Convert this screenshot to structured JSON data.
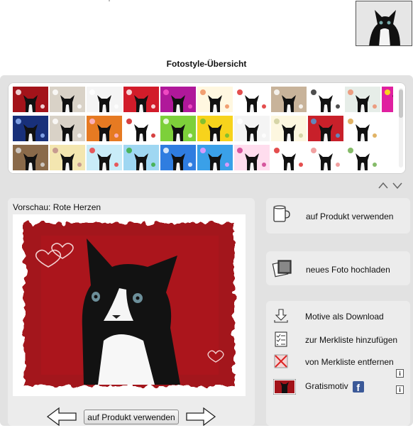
{
  "header": {
    "title": "Fotostyle-Übersicht"
  },
  "gallery": {
    "rows": [
      [
        "red-frame",
        "cat-white",
        "cat-plain",
        "hearts-red",
        "pink-christmas",
        "orange-note",
        "hearts-outline",
        "cat-sepia",
        "cat-dark",
        "fruit-pastel",
        "pop-art"
      ],
      [
        "night-snow",
        "cat-white",
        "orange-bg",
        "red-heart",
        "stars-green",
        "sun-yellow",
        "cat-grey",
        "note-paper",
        "red-roses",
        "cake-gold"
      ],
      [
        "wood-door",
        "banner-yellow",
        "balloons",
        "toys",
        "blue-text",
        "blue-waves",
        "pink-flowers",
        "hearts-strip",
        "hearts-light",
        "green-leaf"
      ]
    ]
  },
  "preview": {
    "label": "Vorschau: Rote Herzen"
  },
  "buttons": {
    "use_product": "auf Produkt verwenden",
    "upload_photo": "neues Foto hochladen",
    "use_product_bottom": "auf Produkt verwenden"
  },
  "list": {
    "download": "Motive als Download",
    "add_watchlist": "zur Merkliste hinzufügen",
    "remove_watchlist": "von Merkliste entfernen",
    "free_motif": "Gratismotiv",
    "info_glyph": "i",
    "fb_glyph": "f"
  },
  "colors": {
    "accent_red": "#a3131a",
    "panel_gray": "#e2e2e2",
    "facebook_blue": "#3b5998"
  },
  "icons": {
    "mug": "mug-icon",
    "photos": "photo-stack-icon",
    "download": "download-arrow-icon",
    "checklist": "checklist-icon",
    "remove": "remove-x-icon",
    "facebook": "facebook-icon",
    "info": "info-icon",
    "scroll_up": "chevron-up-icon",
    "scroll_down": "chevron-down-icon",
    "prev": "arrow-left-icon",
    "next": "arrow-right-icon"
  }
}
